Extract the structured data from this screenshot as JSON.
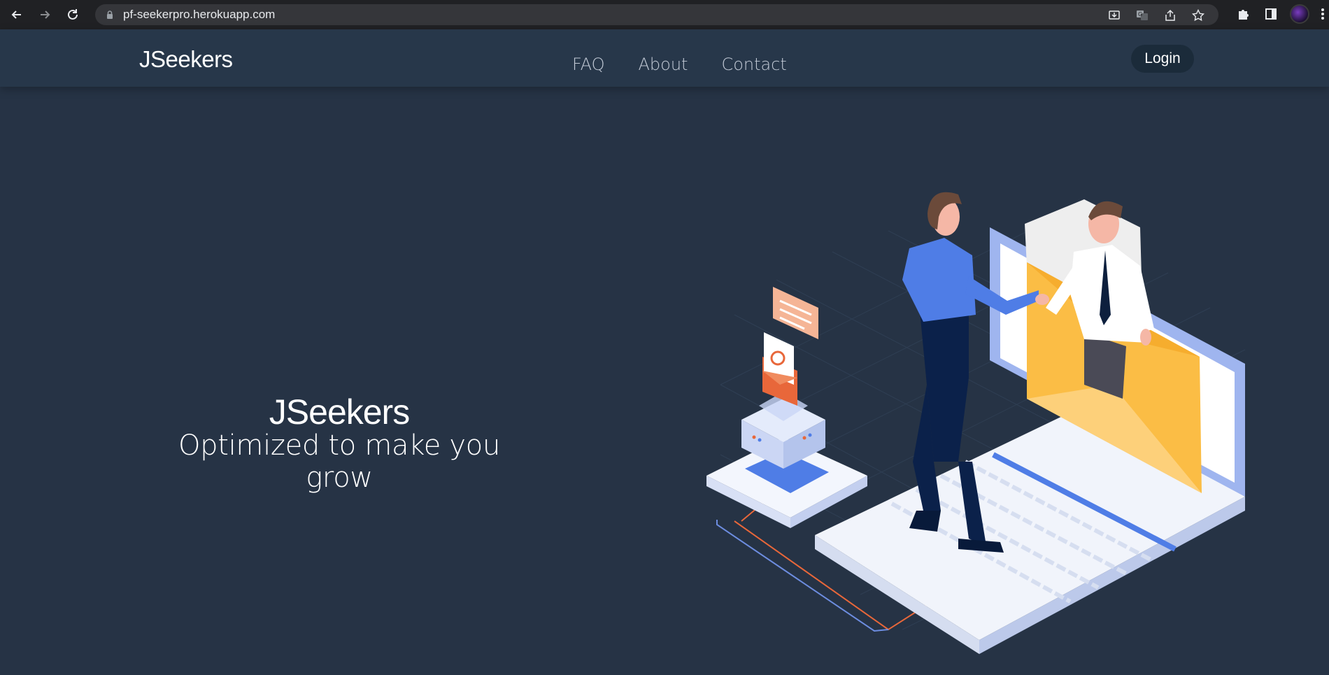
{
  "browser": {
    "url": "pf-seekerpro.herokuapp.com",
    "icons": [
      "back-arrow-icon",
      "forward-arrow-icon",
      "reload-icon",
      "lock-icon",
      "install-app-icon",
      "translate-icon",
      "share-icon",
      "bookmark-star-icon",
      "extensions-puzzle-icon",
      "side-panel-icon",
      "profile-avatar",
      "kebab-menu-icon"
    ]
  },
  "header": {
    "brand": "JSeekers",
    "nav": [
      "FAQ",
      "About",
      "Contact"
    ],
    "login_label": "Login"
  },
  "hero": {
    "title": "JSeekers",
    "subtitle": "Optimized to make you grow"
  },
  "colors": {
    "background": "#263345",
    "header": "#27374a",
    "chrome": "#202124",
    "omnibox": "#35363a",
    "accent_blue": "#4f7de6",
    "envelope_yellow": "#fbbd45",
    "accent_orange": "#e86a3c"
  }
}
